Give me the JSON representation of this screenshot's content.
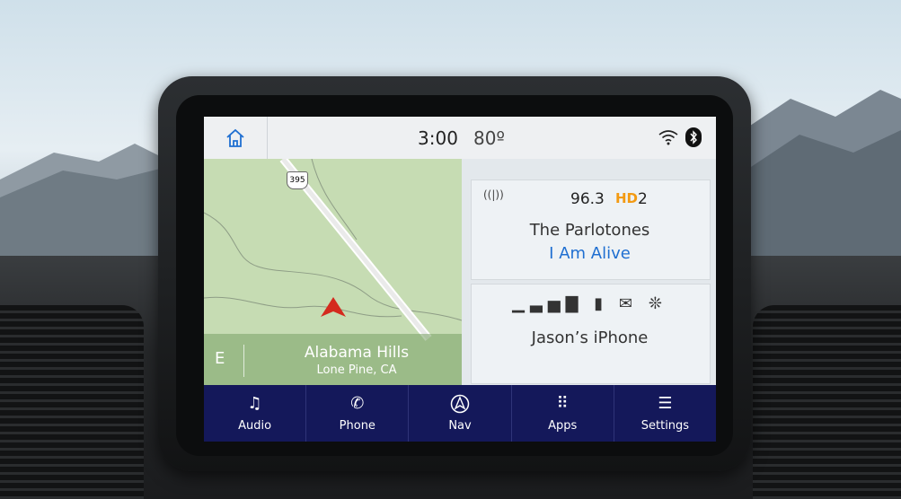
{
  "status": {
    "time": "3:00",
    "temperature": "80º",
    "home_icon": "home-icon",
    "wifi_icon": "wifi-icon",
    "bluetooth_icon": "bluetooth-icon"
  },
  "map": {
    "route_shield": "395",
    "compass": "E",
    "place": "Alabama Hills",
    "place_sub": "Lone Pine, CA",
    "position_icon": "vehicle-arrow-icon"
  },
  "radio": {
    "frequency": "96.3",
    "hd_label": "HD",
    "hd_channel": "2",
    "artist": "The Parlotones",
    "song": "I Am Alive"
  },
  "phone": {
    "device": "Jason’s iPhone",
    "icons": [
      "signal-icon",
      "battery-icon",
      "mail-icon",
      "voice-icon"
    ]
  },
  "nav": [
    {
      "label": "Audio",
      "icon": "music-note-icon"
    },
    {
      "label": "Phone",
      "icon": "phone-icon"
    },
    {
      "label": "Nav",
      "icon": "navigation-icon"
    },
    {
      "label": "Apps",
      "icon": "apps-grid-icon"
    },
    {
      "label": "Settings",
      "icon": "settings-sliders-icon"
    }
  ],
  "colors": {
    "nav_bar": "#14185a",
    "song_accent": "#1f6fd1",
    "hd_accent": "#f39a12",
    "map_green": "#c6dcb3"
  }
}
